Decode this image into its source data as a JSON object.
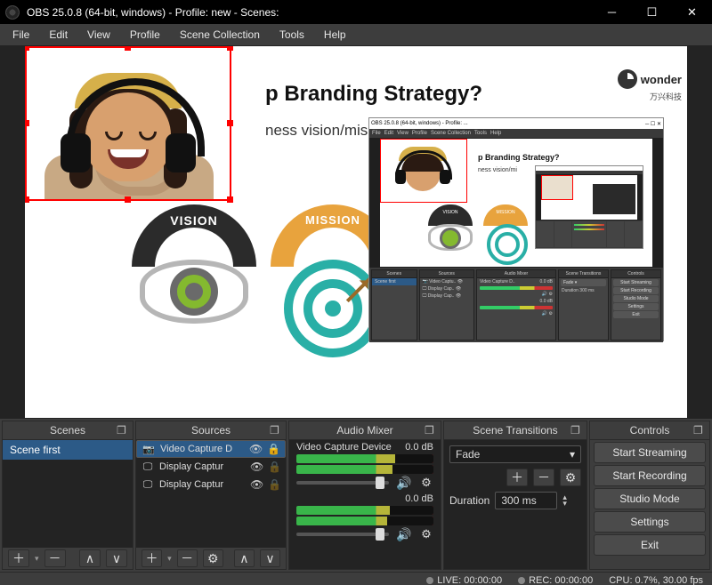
{
  "window": {
    "title": "OBS 25.0.8 (64-bit, windows) - Profile: new - Scenes:"
  },
  "menu": [
    "File",
    "Edit",
    "View",
    "Profile",
    "Scene Collection",
    "Tools",
    "Help"
  ],
  "slide": {
    "title": "p Branding Strategy?",
    "subtitle": "ness vision/mis",
    "vision_label": "VISION",
    "mission_label": "MISSION",
    "brand": "wonder",
    "brand_sub": "万兴科技"
  },
  "nested": {
    "title": "OBS 25.0.8 (64-bit, windows) - Profile: ...",
    "slide_title": "p Branding Strategy?",
    "slide_sub": "ness vision/mi",
    "vision": "VISION",
    "mission": "MISSION"
  },
  "panels": {
    "scenes": {
      "title": "Scenes",
      "items": [
        "Scene first"
      ]
    },
    "sources": {
      "title": "Sources",
      "items": [
        {
          "icon": "📷",
          "label": "Video Capture D",
          "visible": true,
          "locked": true
        },
        {
          "icon": "🖵",
          "label": "Display Captur",
          "visible": true,
          "locked": false
        },
        {
          "icon": "🖵",
          "label": "Display Captur",
          "visible": true,
          "locked": false
        }
      ]
    },
    "mixer": {
      "title": "Audio Mixer",
      "channels": [
        {
          "name": "Video Capture Device",
          "db": "0.0 dB",
          "level": 72,
          "thumb": 86
        },
        {
          "name": "",
          "db": "0.0 dB",
          "level": 68,
          "thumb": 86
        }
      ]
    },
    "transitions": {
      "title": "Scene Transitions",
      "selected": "Fade",
      "duration_label": "Duration",
      "duration_value": "300 ms"
    },
    "controls": {
      "title": "Controls",
      "buttons": [
        "Start Streaming",
        "Start Recording",
        "Studio Mode",
        "Settings",
        "Exit"
      ]
    }
  },
  "status": {
    "live": "LIVE: 00:00:00",
    "rec": "REC: 00:00:00",
    "cpu": "CPU: 0.7%, 30.00 fps"
  }
}
